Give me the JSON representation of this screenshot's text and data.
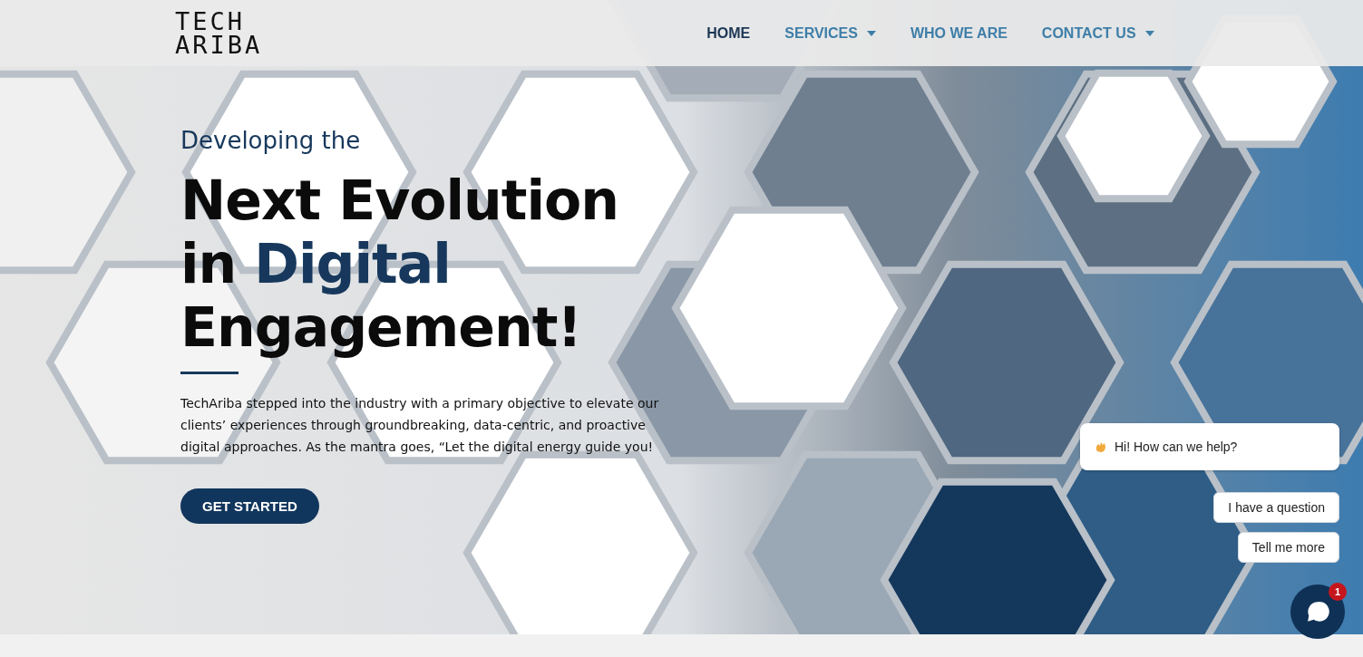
{
  "header": {
    "logo": [
      "TECH",
      "ARIBA"
    ],
    "nav": [
      {
        "label": "HOME",
        "selected": true,
        "dropdown": false
      },
      {
        "label": "SERVICES",
        "selected": false,
        "dropdown": true
      },
      {
        "label": "WHO WE ARE",
        "selected": false,
        "dropdown": false
      },
      {
        "label": "CONTACT US",
        "selected": false,
        "dropdown": true
      }
    ]
  },
  "hero": {
    "kicker": "Developing the",
    "headline": [
      {
        "text": "Next Evolution in ",
        "accent": false
      },
      {
        "text": "Digital",
        "accent": true
      },
      {
        "text": " Engagement!",
        "accent": false
      }
    ],
    "body": "TechAriba stepped into the industry with a primary objective to elevate our clients’ experiences through groundbreaking, data-centric, and proactive digital approaches. As the mantra goes, “Let the digital energy guide you!",
    "button": "GET STARTED"
  },
  "chat": {
    "greeting": "Hi! How can we help?",
    "replies": [
      "I have a question",
      "Tell me more"
    ],
    "badge": "1"
  }
}
